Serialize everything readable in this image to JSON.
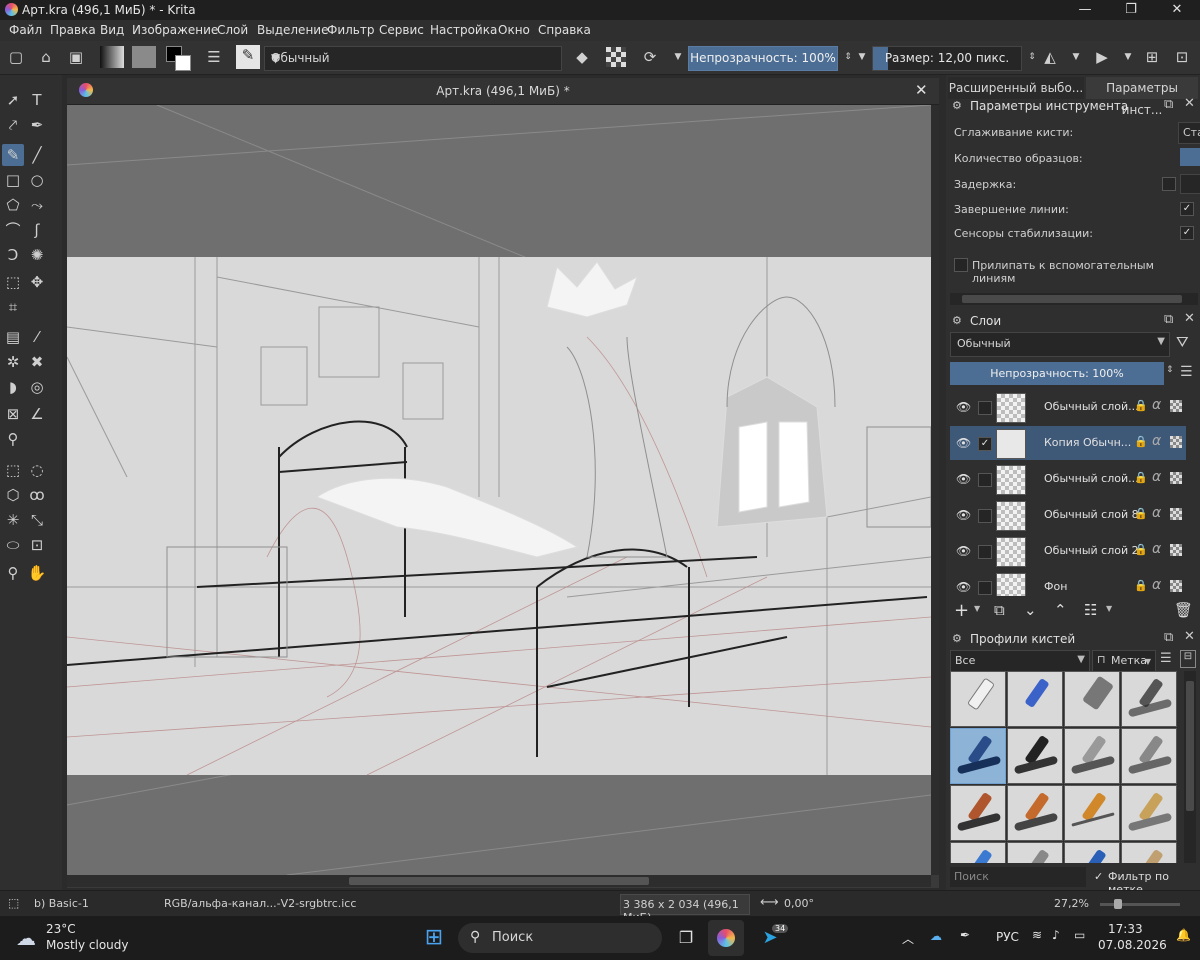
{
  "window": {
    "title": "Арт.kra (496,1 МиБ) * - Krita",
    "controls": [
      "—",
      "❐",
      "✕"
    ]
  },
  "menu": [
    "Файл",
    "Правка",
    "Вид",
    "Изображение",
    "Слой",
    "Выделение",
    "Фильтр",
    "Сервис",
    "Настройка",
    "Окно",
    "Справка"
  ],
  "toolbar": {
    "blend_mode": "Обычный",
    "opacity_label": "Непрозрачность: 100%",
    "size_label": "Размер: 12,00 пикс.",
    "size_fraction": 0.1
  },
  "document": {
    "title": "Арт.kra (496,1 МиБ) *"
  },
  "dock": {
    "tabs": [
      "Расширенный выбо...",
      "Параметры инст..."
    ],
    "tool_options": {
      "title": "Параметры инструмента",
      "rows": [
        {
          "label": "Сглаживание кисти:",
          "value": "Ста"
        },
        {
          "label": "Количество образцов:",
          "value": ""
        },
        {
          "label": "Задержка:",
          "value": ""
        },
        {
          "label": "Завершение линии:",
          "value": "✓"
        },
        {
          "label": "Сенсоры стабилизации:",
          "value": "✓"
        }
      ],
      "snap_label": "Прилипать к вспомогательным линиям"
    },
    "layers": {
      "title": "Слои",
      "blend_mode": "Обычный",
      "opacity_label": "Непрозрачность:  100%",
      "items": [
        {
          "name": "Обычный слой...",
          "selected": false,
          "checked": false
        },
        {
          "name": "Копия Обычн...",
          "selected": true,
          "checked": true
        },
        {
          "name": "Обычный слой...",
          "selected": false,
          "checked": false
        },
        {
          "name": "Обычный слой 8",
          "selected": false,
          "checked": false
        },
        {
          "name": "Обычный слой 2",
          "selected": false,
          "checked": false
        },
        {
          "name": "Фон",
          "selected": false,
          "checked": false
        }
      ]
    },
    "brushes": {
      "title": "Профили кистей",
      "filter": "Все",
      "tag_label": "Метка",
      "search_placeholder": "Поиск",
      "filter_by_tag": "Фильтр по метке"
    }
  },
  "status": {
    "brush": "b) Basic-1",
    "color_profile": "RGB/альфа-канал...-V2-srgbtrc.icc",
    "dimensions": "3 386 x 2 034 (496,1 МиБ)",
    "rotation": "0,00°",
    "zoom": "27,2%"
  },
  "taskbar": {
    "weather_temp": "23°C",
    "weather_desc": "Mostly cloudy",
    "search_label": "Поиск",
    "telegram_badge": "34",
    "lang": "РУС",
    "time": "17:33",
    "date": "07.08.2026"
  }
}
